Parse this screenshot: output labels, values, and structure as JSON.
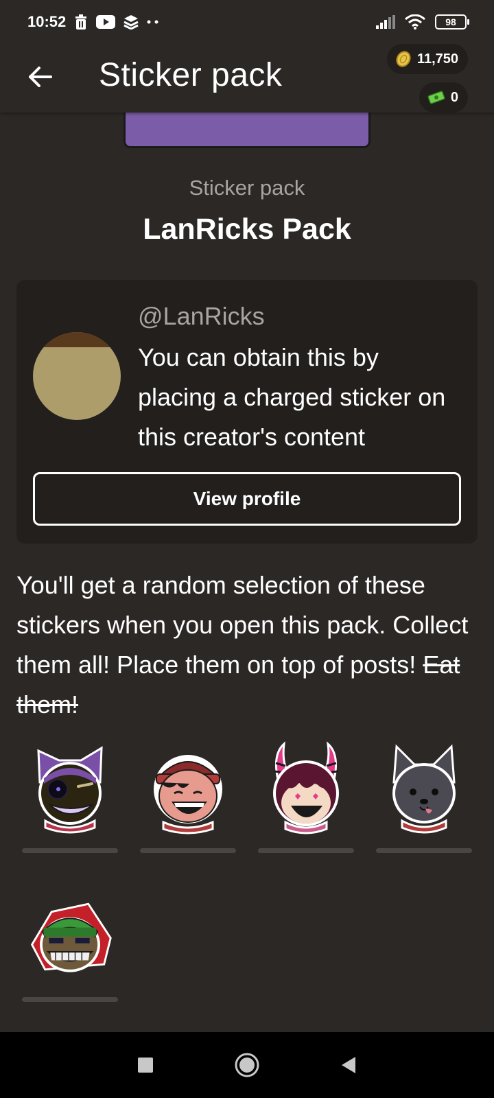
{
  "status_bar": {
    "time": "10:52",
    "battery": "98",
    "icons": [
      "trash-icon",
      "youtube-icon",
      "layers-icon",
      "more-dots-icon",
      "signal-icon",
      "wifi-icon",
      "battery-icon"
    ]
  },
  "app_bar": {
    "title": "Sticker pack",
    "back_icon": "arrow-left-icon",
    "coins": "11,750",
    "cash": "0"
  },
  "pack": {
    "label": "Sticker pack",
    "title": "LanRicks Pack"
  },
  "creator": {
    "handle": "@LanRicks",
    "description": "You can obtain this by placing a charged sticker on this creator's content",
    "button_label": "View profile"
  },
  "description": {
    "text": "You'll get a random selection of these stickers when you open this pack. Collect them all! Place them on top of posts! ",
    "strikethrough": "Eat them!"
  },
  "stickers": [
    {
      "name": "purple-hood-sticker"
    },
    {
      "name": "red-beanie-sticker"
    },
    {
      "name": "pink-horns-sticker"
    },
    {
      "name": "gray-dog-sticker"
    },
    {
      "name": "green-hat-sticker"
    }
  ],
  "colors": {
    "background": "#2c2826",
    "card": "#221f1d",
    "muted_text": "#a8a4a0",
    "coin": "#e9c44a",
    "cash": "#6fcf4a"
  }
}
